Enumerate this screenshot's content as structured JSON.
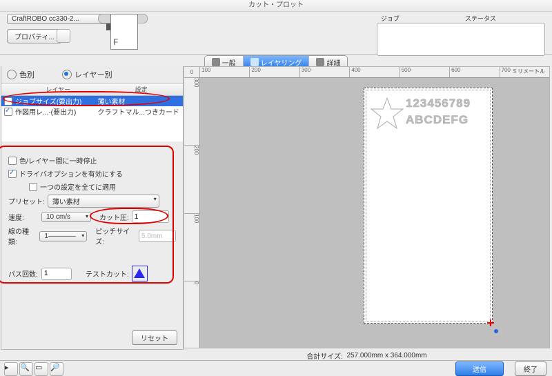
{
  "window_title": "カット・プロット",
  "toolbar": {
    "device": "CraftROBO cc330-2...",
    "properties": "プロパティ...",
    "page_glyph": "F"
  },
  "jobpanel": {
    "col_job": "ジョブ",
    "col_status": "ステータス"
  },
  "tabs": {
    "general": "一般",
    "layering": "レイヤリング",
    "advanced": "詳細"
  },
  "modes": {
    "by_color": "色別",
    "by_layer": "レイヤー別"
  },
  "list": {
    "col_layer": "レイヤー",
    "col_setting": "設定",
    "rows": [
      {
        "label": "ジョブサイズ(要出力)",
        "setting": "薄い素材"
      },
      {
        "label": "作図用レ...-(要出力)",
        "setting": "クラフトマル...つきカード"
      }
    ]
  },
  "opts": {
    "pause_label": "色/レイヤー間に一時停止",
    "driver_enable": "ドライバオプションを有効にする",
    "apply_all": "一つの設定を全てに適用",
    "preset": "プリセット:",
    "preset_value": "薄い素材",
    "speed": "速度:",
    "speed_value": "10 cm/s",
    "cut_pressure": "カット圧:",
    "cut_pressure_value": "1",
    "line_type": "線の種類:",
    "line_type_value": "1————",
    "pitch": "ピッチサイズ:",
    "pitch_value": "5.0mm",
    "passes": "パス回数:",
    "passes_value": "1",
    "test_cut": "テストカット:"
  },
  "reset": "リセット",
  "ruler": {
    "units": "ミリメートル",
    "h": [
      "0",
      "100",
      "200",
      "300",
      "400",
      "500",
      "600",
      "700"
    ],
    "v": [
      "0",
      "100",
      "200",
      "300"
    ]
  },
  "artwork": {
    "line1": "123456789",
    "line2": "ABCDEFG"
  },
  "status": {
    "label": "合計サイズ:",
    "value": "257.000mm x 364.000mm"
  },
  "actions": {
    "send": "送信",
    "done": "終了"
  }
}
